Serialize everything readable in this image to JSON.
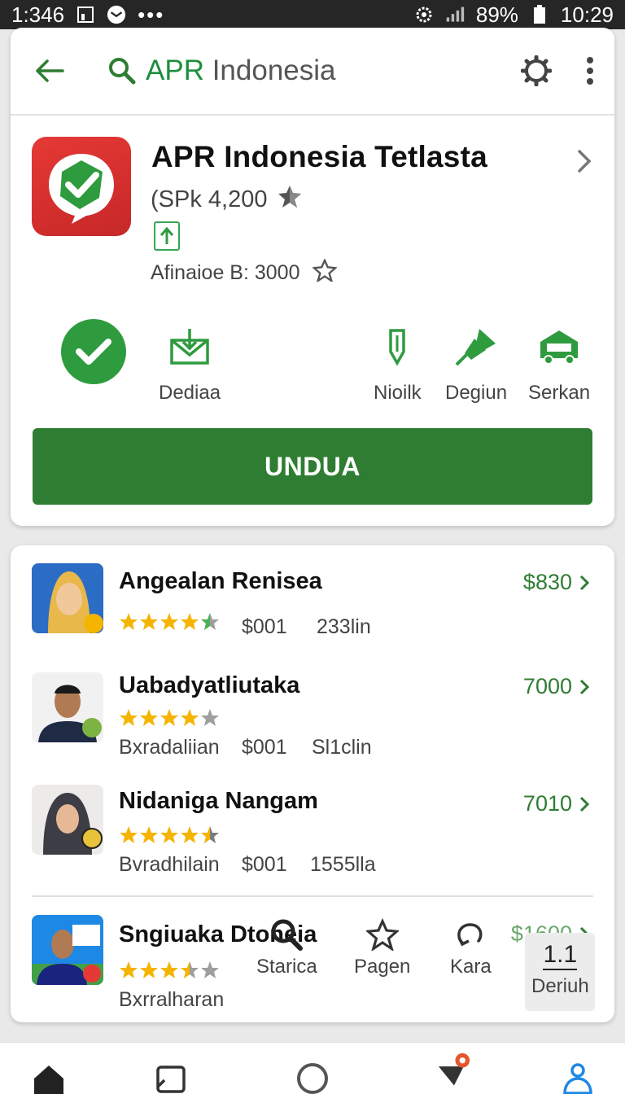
{
  "status_bar": {
    "left_time": "1:346",
    "battery_pct": "9%",
    "signal_label": "8",
    "clock": "10:29"
  },
  "search": {
    "query_prefix": "APR",
    "query_rest": "Indonesia"
  },
  "app": {
    "title": "APR Indonesia Tetlasta",
    "price": "(SPk 4,200",
    "meta": "Afinaioe B: 3000"
  },
  "actions": [
    {
      "label": "Dediaa"
    },
    {
      "label": "Nioilk"
    },
    {
      "label": "Degiun"
    },
    {
      "label": "Serkan"
    }
  ],
  "install_label": "UNDUA",
  "list": [
    {
      "name": "Angealan Renisea",
      "price": "$830",
      "rating": 4.5,
      "meta_a": "$001",
      "meta_b": "233lin"
    },
    {
      "name": "Uabadyatliutaka",
      "price": "7000",
      "rating": 4.0,
      "meta_a": "Bxradaliian",
      "meta_b": "$001",
      "meta_c": "Sl1clin"
    },
    {
      "name": "Nidaniga Nangam",
      "price": "7010",
      "rating": 4.5,
      "meta_a": "Bvradhilain",
      "meta_b": "$001",
      "meta_c": "1555lla"
    },
    {
      "name": "Sngiuaka Dtoneia",
      "price": "$1600",
      "rating": 3.5,
      "meta_a": "Bxrralharan"
    }
  ],
  "mini_nav": [
    {
      "label": "Starica",
      "icon": "search-icon"
    },
    {
      "label": "Pagen",
      "icon": "star-icon"
    },
    {
      "label": "Kara",
      "icon": "refresh-icon"
    },
    {
      "label": "Deriuh",
      "icon": "score-icon",
      "value": "1.1"
    }
  ],
  "colors": {
    "accent": "#2e7d32",
    "accent_light": "#1e8e3e",
    "app_icon_red": "#d32f2f",
    "star": "#f5b400"
  }
}
